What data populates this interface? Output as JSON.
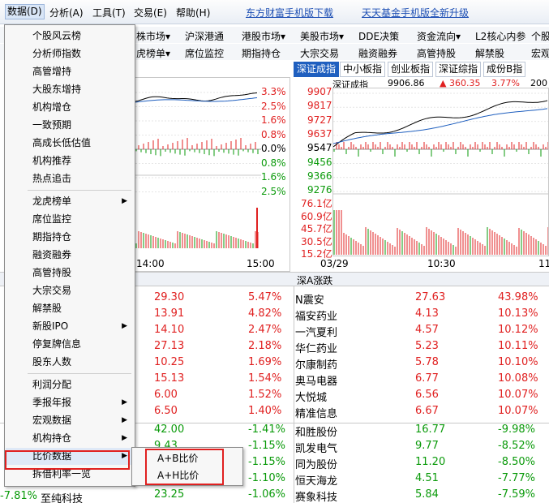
{
  "menubar": {
    "items": [
      "数据(D)",
      "分析(A)",
      "工具(T)",
      "交易(E)",
      "帮助(H)"
    ],
    "promos": [
      "东方财富手机版下载",
      "天天基金手机版全新升级"
    ]
  },
  "toolbar": {
    "row1": [
      "株市场▾",
      "沪深港通",
      "港股市场▾",
      "美股市场▾",
      "DDE决策",
      "资金流向▾",
      "L2核心内参",
      "个股"
    ],
    "row2": [
      "虎榜单▾",
      "席位监控",
      "期指持仓",
      "大宗交易",
      "融资融券",
      "高管持股",
      "解禁股",
      "宏观"
    ]
  },
  "tabs": [
    "深证成指",
    "中小板指",
    "创业板指",
    "深证综指",
    "成份B指"
  ],
  "left_chart": {
    "pct_labels": [
      "3.3%",
      "2.5%",
      "1.6%",
      "0.8%",
      "0.0%",
      "0.8%",
      "1.6%",
      "2.5%"
    ],
    "time_labels": [
      "14:00",
      "15:00"
    ]
  },
  "right_chart": {
    "header": {
      "name": "深证成指",
      "value": "9906.86",
      "change": "▲ 360.35",
      "pct": "3.77%",
      "extra": "200"
    },
    "price_labels": [
      "9907",
      "9817",
      "9727",
      "9637",
      "9547",
      "9456",
      "9366",
      "9276"
    ],
    "vol_labels": [
      "76.1亿",
      "60.9亿",
      "45.7亿",
      "30.5亿",
      "15.2亿"
    ],
    "time_labels": [
      "03/29",
      "10:30",
      "11"
    ]
  },
  "table_header": "深A涨跌",
  "left_table": [
    {
      "price": "29.30",
      "pct": "5.47%",
      "color": "green-red"
    },
    {
      "price": "13.91",
      "pct": "4.82%"
    },
    {
      "price": "14.10",
      "pct": "2.47%"
    },
    {
      "price": "27.13",
      "pct": "2.18%"
    },
    {
      "price": "10.25",
      "pct": "1.69%"
    },
    {
      "price": "15.13",
      "pct": "1.54%"
    },
    {
      "price": "6.00",
      "pct": "1.52%"
    },
    {
      "price": "6.50",
      "pct": "1.40%"
    },
    {
      "price": "42.00",
      "pct": "-1.41%"
    },
    {
      "price": "9.43",
      "pct": "-1.15%"
    },
    {
      "price": "",
      "pct": "-1.15%"
    },
    {
      "price": "",
      "pct": "-1.10%"
    },
    {
      "price": "23.25",
      "pct": "-1.06%"
    }
  ],
  "left_partial": {
    "pct": "-7.81%",
    "name": "至纯科技"
  },
  "right_table": [
    {
      "name": "N震安",
      "price": "27.63",
      "pct": "43.98%"
    },
    {
      "name": "福安药业",
      "price": "4.13",
      "pct": "10.13%"
    },
    {
      "name": "一汽夏利",
      "price": "4.57",
      "pct": "10.12%"
    },
    {
      "name": "华仁药业",
      "price": "5.23",
      "pct": "10.11%"
    },
    {
      "name": "尔康制药",
      "price": "5.78",
      "pct": "10.10%"
    },
    {
      "name": "奥马电器",
      "price": "6.77",
      "pct": "10.08%"
    },
    {
      "name": "大悦城",
      "price": "6.56",
      "pct": "10.07%"
    },
    {
      "name": "精准信息",
      "price": "6.67",
      "pct": "10.07%"
    },
    {
      "name": "和胜股份",
      "price": "16.77",
      "pct": "-9.98%"
    },
    {
      "name": "凯发电气",
      "price": "9.77",
      "pct": "-8.52%"
    },
    {
      "name": "同为股份",
      "price": "11.20",
      "pct": "-8.50%"
    },
    {
      "name": "恒天海龙",
      "price": "4.51",
      "pct": "-7.77%"
    },
    {
      "name": "赛象科技",
      "price": "5.84",
      "pct": "-7.59%"
    }
  ],
  "dropdown": {
    "group1": [
      "个股风云榜",
      "分析师指数",
      "高管增持",
      "大股东增持",
      "机构增仓",
      "一致预期",
      "高成长低估值",
      "机构推荐",
      "热点追击"
    ],
    "group2": [
      "龙虎榜单",
      "席位监控",
      "期指持仓",
      "融资融券",
      "高管持股",
      "大宗交易",
      "解禁股",
      "新股IPO",
      "停复牌信息",
      "股东人数"
    ],
    "group3": [
      "利润分配",
      "季报年报",
      "宏观数据",
      "机构持仓",
      "比价数据",
      "拆借利率一览"
    ],
    "submenu": [
      "A+B比价",
      "A+H比价"
    ]
  },
  "colors": {
    "up": "#e02020",
    "down": "#0a9a0a",
    "accent": "#1f5fbf",
    "highlight_box": "#e02020"
  }
}
